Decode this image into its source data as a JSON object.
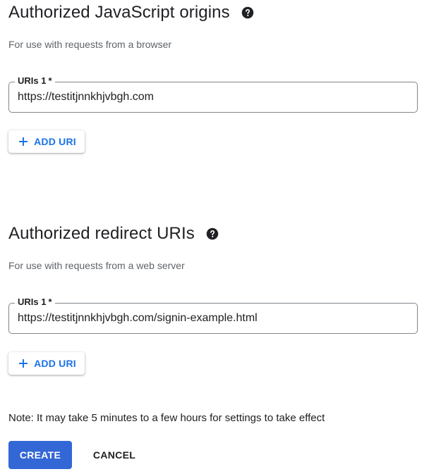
{
  "js_origins": {
    "title": "Authorized JavaScript origins",
    "description": "For use with requests from a browser",
    "help_icon": "help-circle-icon",
    "field": {
      "label": "URIs 1",
      "required_marker": "*",
      "value": "https://testitjnnkhjvbgh.com"
    },
    "add_button": {
      "icon": "plus-icon",
      "label": "ADD URI"
    }
  },
  "redirect_uris": {
    "title": "Authorized redirect URIs",
    "description": "For use with requests from a web server",
    "help_icon": "help-circle-icon",
    "field": {
      "label": "URIs 1",
      "required_marker": "*",
      "value": "https://testitjnnkhjvbgh.com/signin-example.html"
    },
    "add_button": {
      "icon": "plus-icon",
      "label": "ADD URI"
    }
  },
  "note": "Note: It may take 5 minutes to a few hours for settings to take effect",
  "actions": {
    "create_label": "CREATE",
    "cancel_label": "CANCEL"
  },
  "colors": {
    "accent": "#1a73e8",
    "primary_button": "#3367d6",
    "text": "#202124",
    "secondary_text": "#5f6368",
    "field_border": "#80868b"
  }
}
